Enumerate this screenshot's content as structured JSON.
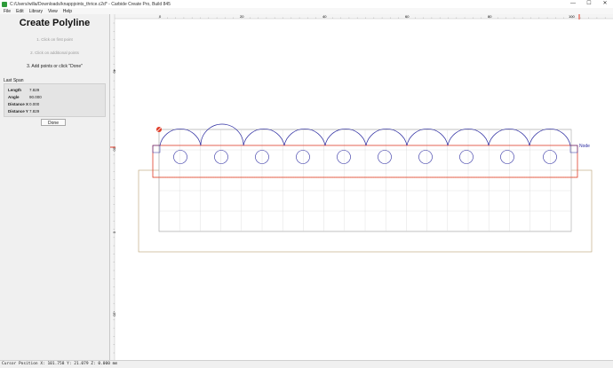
{
  "window": {
    "title": "C:/Users/willa/Downloads/knappjoints_thrice.c2d* - Carbide Create Pro, Build 845",
    "minimize": "—",
    "maximize": "☐",
    "close": "✕"
  },
  "menu": [
    "File",
    "Edit",
    "Library",
    "View",
    "Help"
  ],
  "panel": {
    "title": "Create Polyline",
    "steps": [
      "1. Click on first point",
      "2. Click on additional points",
      "3. Add points or click \"Done\""
    ],
    "last_span_label": "Last Span",
    "last_span": [
      {
        "key": "Length",
        "value": "7.829"
      },
      {
        "key": "Angle",
        "value": "90.000"
      },
      {
        "key": "Distance X",
        "value": "0.000"
      },
      {
        "key": "Distance Y",
        "value": "7.829"
      }
    ],
    "done_label": "Done"
  },
  "ruler": {
    "top_ticks": [
      "0",
      "20",
      "40",
      "60",
      "80",
      "100"
    ],
    "left_ticks": [
      "40",
      "20",
      "0",
      "-20"
    ]
  },
  "canvas": {
    "node_label": "Node",
    "colors": {
      "grid": "#d8d8d8",
      "shape": "#2a2aa0",
      "stock": "#b8a070",
      "selection": "#e03c28",
      "toolpath": "#d4a020"
    }
  },
  "status": {
    "text": "Cursor Position X: 101.758 Y: 21.079 Z: 0.000 mm"
  }
}
